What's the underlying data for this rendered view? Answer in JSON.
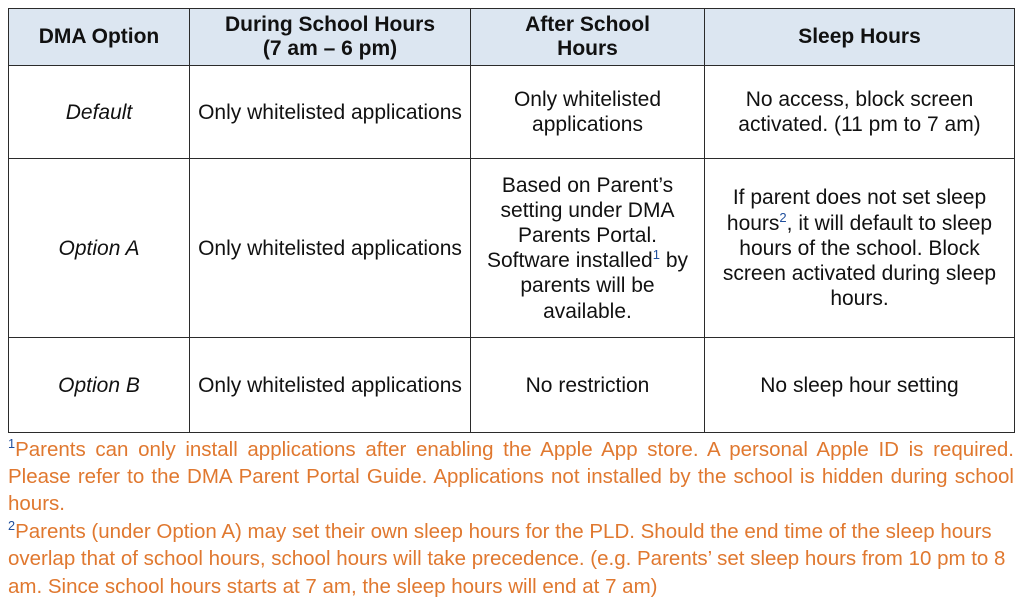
{
  "table": {
    "headers": [
      {
        "line1": "DMA Option",
        "line2": ""
      },
      {
        "line1": "During School Hours",
        "line2": "(7 am – 6 pm)"
      },
      {
        "line1": "After School",
        "line2": "Hours"
      },
      {
        "line1": "Sleep Hours",
        "line2": ""
      }
    ],
    "rows": [
      {
        "option": "Default",
        "during_school": "Only whitelisted applications",
        "after_school_pre": "Only whitelisted applications",
        "after_school_mark": "",
        "after_school_post": "",
        "sleep_pre": "No access, block screen activated. (11 pm to 7 am)",
        "sleep_mark": "",
        "sleep_post": ""
      },
      {
        "option": "Option A",
        "during_school": "Only whitelisted applications",
        "after_school_pre": "Based on Parent’s setting under DMA Parents Portal. Software installed",
        "after_school_mark": "1",
        "after_school_post": " by parents will be available.",
        "sleep_pre": "If parent does not set sleep hours",
        "sleep_mark": "2",
        "sleep_post": ", it will default to sleep hours of the school. Block screen activated during sleep hours."
      },
      {
        "option": "Option B",
        "during_school": "Only whitelisted applications",
        "after_school_pre": "No restriction",
        "after_school_mark": "",
        "after_school_post": "",
        "sleep_pre": "No sleep hour setting",
        "sleep_mark": "",
        "sleep_post": ""
      }
    ]
  },
  "footnotes": [
    {
      "mark": "1",
      "text": "Parents can only install applications after enabling the Apple App store. A personal Apple ID is required. Please refer to the DMA Parent Portal Guide. Applications not installed by the school is hidden during school hours."
    },
    {
      "mark": "2",
      "text": "Parents (under Option A) may set their own sleep hours for the PLD. Should the end time of the sleep hours overlap that of school hours, school hours will take precedence. (e.g. Parents’ set sleep hours from 10 pm to 8 am. Since school hours starts at 7 am, the sleep hours will end at 7 am)"
    }
  ],
  "colors": {
    "header_background": "#dce6f1",
    "header_text": "#10265e",
    "body_text": "#111111",
    "footnote_text": "#e0782f",
    "footnote_mark": "#1f4e9c",
    "border": "#2b2b2b"
  }
}
